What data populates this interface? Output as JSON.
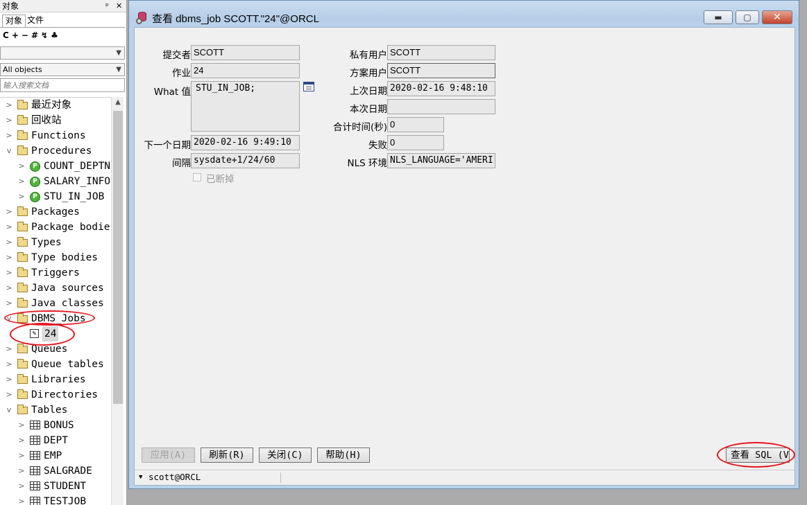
{
  "left_panel": {
    "title": "对象",
    "pin_icon": "pin-icon",
    "close_icon": "close-icon",
    "tabs": [
      "对象",
      "文件"
    ],
    "toolbar": [
      "C",
      "+",
      "−",
      "#",
      "↯",
      "♣"
    ],
    "owner_combo": "",
    "filter_combo": "All objects",
    "search_placeholder": "输入搜索文档",
    "tree": [
      {
        "label": "最近对象",
        "kind": "folder",
        "expander": ">",
        "depth": 0
      },
      {
        "label": "回收站",
        "kind": "folder",
        "expander": ">",
        "depth": 0
      },
      {
        "label": "Functions",
        "kind": "folder",
        "expander": ">",
        "depth": 0
      },
      {
        "label": "Procedures",
        "kind": "folder",
        "expander": "v",
        "depth": 0
      },
      {
        "label": "COUNT_DEPTN",
        "kind": "procedure",
        "expander": ">",
        "depth": 1
      },
      {
        "label": "SALARY_INFO",
        "kind": "procedure",
        "expander": ">",
        "depth": 1
      },
      {
        "label": "STU_IN_JOB",
        "kind": "procedure",
        "expander": ">",
        "depth": 1
      },
      {
        "label": "Packages",
        "kind": "folder",
        "expander": ">",
        "depth": 0
      },
      {
        "label": "Package bodie",
        "kind": "folder",
        "expander": ">",
        "depth": 0
      },
      {
        "label": "Types",
        "kind": "folder",
        "expander": ">",
        "depth": 0
      },
      {
        "label": "Type bodies",
        "kind": "folder",
        "expander": ">",
        "depth": 0
      },
      {
        "label": "Triggers",
        "kind": "folder",
        "expander": ">",
        "depth": 0
      },
      {
        "label": "Java sources",
        "kind": "folder",
        "expander": ">",
        "depth": 0
      },
      {
        "label": "Java classes",
        "kind": "folder",
        "expander": ">",
        "depth": 0
      },
      {
        "label": "DBMS_Jobs",
        "kind": "folder",
        "expander": "v",
        "depth": 0
      },
      {
        "label": "24",
        "kind": "job",
        "expander": "",
        "depth": 1,
        "selected": true
      },
      {
        "label": "Queues",
        "kind": "folder",
        "expander": ">",
        "depth": 0
      },
      {
        "label": "Queue tables",
        "kind": "folder",
        "expander": ">",
        "depth": 0
      },
      {
        "label": "Libraries",
        "kind": "folder",
        "expander": ">",
        "depth": 0
      },
      {
        "label": "Directories",
        "kind": "folder",
        "expander": ">",
        "depth": 0
      },
      {
        "label": "Tables",
        "kind": "folder",
        "expander": "v",
        "depth": 0
      },
      {
        "label": "BONUS",
        "kind": "table",
        "expander": ">",
        "depth": 1
      },
      {
        "label": "DEPT",
        "kind": "table",
        "expander": ">",
        "depth": 1
      },
      {
        "label": "EMP",
        "kind": "table",
        "expander": ">",
        "depth": 1
      },
      {
        "label": "SALGRADE",
        "kind": "table",
        "expander": ">",
        "depth": 1
      },
      {
        "label": "STUDENT",
        "kind": "table",
        "expander": ">",
        "depth": 1
      },
      {
        "label": "TESTJOB",
        "kind": "table",
        "expander": ">",
        "depth": 1
      }
    ]
  },
  "dialog": {
    "title": "查看 dbms_job SCOTT.\"24\"@ORCL",
    "window_buttons": {
      "minimize": "▬",
      "maximize": "▢",
      "close": "✕"
    },
    "fields": {
      "submitter_label": "提交者",
      "submitter": "SCOTT",
      "job_label": "作业",
      "job": "24",
      "what_label": "What 值",
      "what": "STU_IN_JOB;",
      "next_date_label": "下一个日期",
      "next_date": "2020-02-16 9:49:10",
      "interval_label": "间隔",
      "interval": "sysdate+1/24/60",
      "broken_label": "已断掉",
      "priv_user_label": "私有用户",
      "priv_user": "SCOTT",
      "schema_user_label": "方案用户",
      "schema_user": "SCOTT",
      "last_date_label": "上次日期",
      "last_date": "2020-02-16 9:48:10",
      "this_date_label": "本次日期",
      "this_date": "",
      "total_time_label": "合计时间(秒)",
      "total_time": "0",
      "failures_label": "失败",
      "failures": "0",
      "nls_env_label": "NLS 环境",
      "nls_env": "NLS_LANGUAGE='AMERI"
    },
    "buttons": {
      "apply": "应用(A)",
      "refresh": "刷新(R)",
      "close": "关闭(C)",
      "help": "帮助(H)",
      "view_sql": "查看 SQL (V"
    },
    "status": "scott@ORCL"
  },
  "colors": {
    "annotation": "#e8141e",
    "dialog_frame": "#b9d1ea"
  }
}
